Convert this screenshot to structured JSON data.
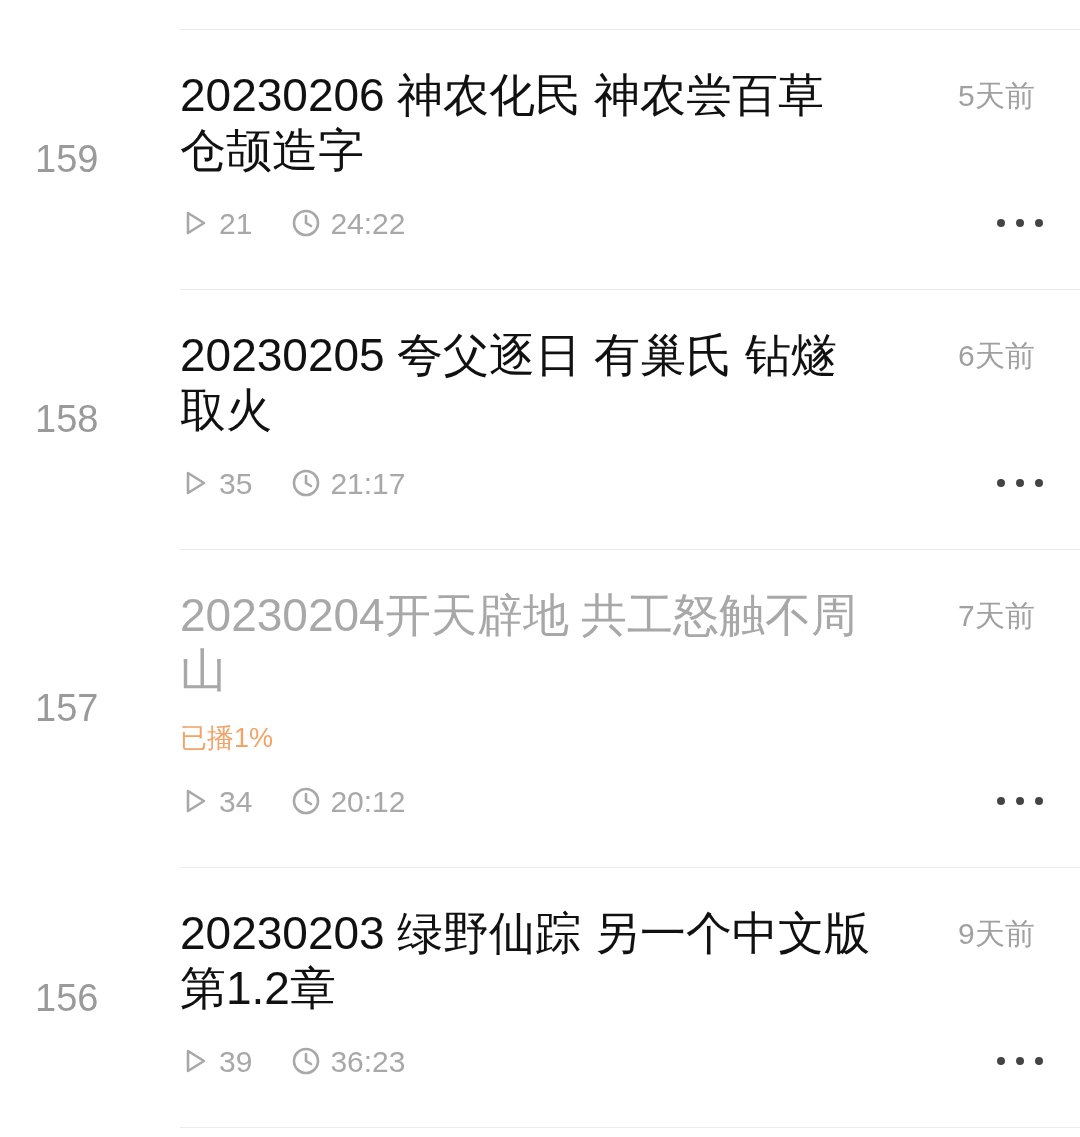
{
  "episodes": [
    {
      "number": "159",
      "title_lines": [
        "20230206 神农化民 神农尝百草",
        "仓颉造字"
      ],
      "ago": "5天前",
      "plays": "21",
      "duration": "24:22",
      "played": false
    },
    {
      "number": "158",
      "title_lines": [
        "20230205 夸父逐日 有巢氏 钻燧",
        "取火"
      ],
      "ago": "6天前",
      "plays": "35",
      "duration": "21:17",
      "played": false
    },
    {
      "number": "157",
      "title_lines": [
        "20230204开天辟地 共工怒触不周",
        "山"
      ],
      "ago": "7天前",
      "progress": "已播1%",
      "plays": "34",
      "duration": "20:12",
      "played": true
    },
    {
      "number": "156",
      "title_lines": [
        "20230203 绿野仙踪 另一个中文版",
        "第1.2章"
      ],
      "ago": "9天前",
      "plays": "39",
      "duration": "36:23",
      "played": false
    }
  ]
}
